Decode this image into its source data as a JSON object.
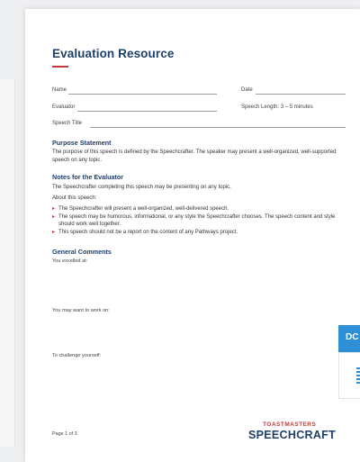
{
  "document": {
    "title": "Evaluation Resource",
    "fields": {
      "name": "Name",
      "date": "Date",
      "evaluator": "Evaluator",
      "speech_length": "Speech Length: 3 – 5 minutes",
      "speech_title": "Speech Title"
    },
    "purpose_heading": "Purpose Statement",
    "purpose_text": "The purpose of this speech is defined by the Speechcrafter. The speaker may present a well-organized, well-supported speech on any topic.",
    "notes_heading": "Notes for the Evaluator",
    "notes_text": "The Speechcrafter completing this speech may be presenting on any topic.",
    "about_label": "About this speech:",
    "bullets": [
      "The Speechcrafter will present a well-organized, well-delivered speech.",
      "The speech may be humorous, informational, or any style the Speechcrafter chooses. The speech content and style should work well together.",
      "This speech should not be a report on the content of any Pathways project."
    ],
    "comments_heading": "General Comments",
    "prompts": {
      "excelled": "You excelled at:",
      "work_on": "You may want to work on:",
      "challenge": "To challenge yourself:"
    },
    "page_label": "Page 1 of 3",
    "brand_top": "TOASTMASTERS",
    "brand_main": "SPEECHCRAFT"
  },
  "download_widget": {
    "tab_label": "DC",
    "icon": "document-icon",
    "accent": "#2e8fd6"
  },
  "colors": {
    "title": "#1f3f6b",
    "accent": "#c23b3b"
  }
}
